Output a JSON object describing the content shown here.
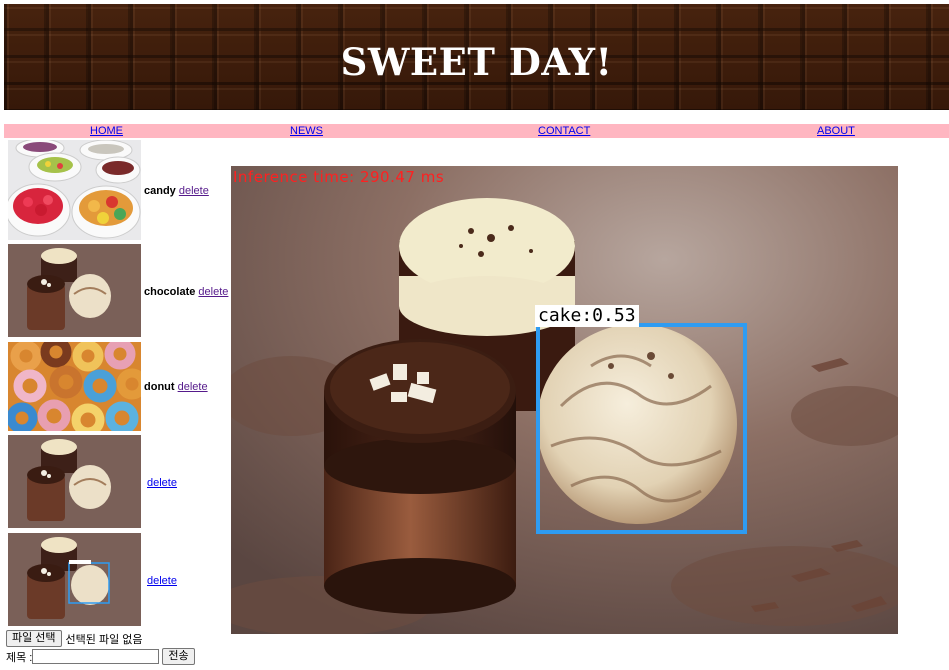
{
  "header": {
    "title": "SWEET DAY!"
  },
  "nav": {
    "items": [
      {
        "label": "HOME"
      },
      {
        "label": "NEWS"
      },
      {
        "label": "CONTACT"
      },
      {
        "label": "ABOUT"
      }
    ]
  },
  "gallery": {
    "items": [
      {
        "name": "candy",
        "delete_label": "delete",
        "image": "candy bowls"
      },
      {
        "name": "chocolate",
        "delete_label": "delete",
        "image": "chocolate desserts"
      },
      {
        "name": "donut",
        "delete_label": "delete",
        "image": "donuts"
      },
      {
        "name": "",
        "delete_label": "delete",
        "image": "chocolate desserts"
      },
      {
        "name": "",
        "delete_label": "delete",
        "image": "chocolate desserts with detection box"
      }
    ]
  },
  "detection": {
    "inference_text": "Inference time: 290.47 ms",
    "label": "cake:0.53",
    "box_color": "#2e9cf2"
  },
  "upload": {
    "file_button": "파일 선택",
    "file_status": "선택된 파일 없음",
    "title_label": "제목 :",
    "title_value": "",
    "submit_label": "전송"
  },
  "colors": {
    "nav_bg": "#ffb6c1",
    "banner_bg": "#3d1d0b"
  }
}
